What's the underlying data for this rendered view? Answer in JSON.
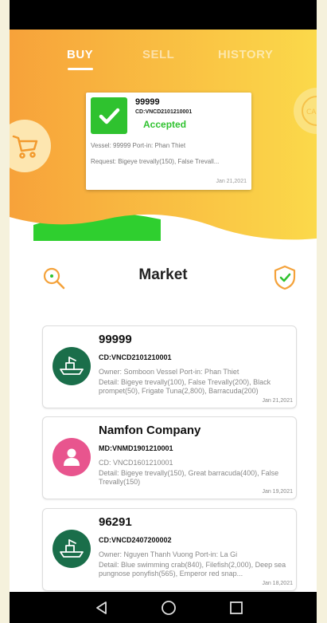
{
  "tabs": {
    "buy": "BUY",
    "sell": "SELL",
    "history": "HISTORY"
  },
  "featured": {
    "id": "99999",
    "cd": "CD:VNCD2101210001",
    "status": "Accepted",
    "vessel_line": "Vessel: 99999  Port-in: Phan Thiet",
    "request_line": "Request: Bigeye trevally(150), False Trevall...",
    "date": "Jan 21,2021"
  },
  "coin_label": "CAFE",
  "market": {
    "title": "Market"
  },
  "listings": [
    {
      "name": "99999",
      "code": "CD:VNCD2101210001",
      "owner_line": "Owner: Somboon Vessel  Port-in: Phan Thiet",
      "detail": "Detail: Bigeye trevally(100), False Trevally(200), Black prompet(50), Frigate Tuna(2,800), Barracuda(200)",
      "date": "Jan 21,2021"
    },
    {
      "name": "Namfon Company",
      "code": "MD:VNMD1901210001",
      "owner_line": "CD: VNCD1601210001",
      "detail": "Detail: Bigeye trevally(150), Great barracuda(400), False Trevally(150)",
      "date": "Jan 19,2021"
    },
    {
      "name": "96291",
      "code": "CD:VNCD2407200002",
      "owner_line": "Owner: Nguyen Thanh Vuong  Port-in: La Gi",
      "detail": "Detail: Blue swimming crab(840), Filefish(2,000), Deep sea pungnose ponyfish(565), Emperor red snap...",
      "date": "Jan 18,2021"
    }
  ],
  "colors": {
    "accent_green": "#2fc22f",
    "boat_avatar": "#1a6e4a",
    "person_avatar": "#e8558e",
    "hero_orange": "#f7a23a",
    "hero_yellow": "#fbd94a"
  }
}
